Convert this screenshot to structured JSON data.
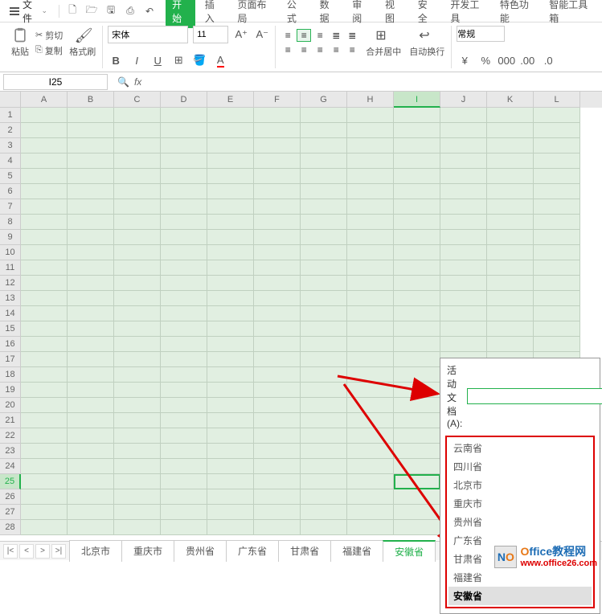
{
  "menu": {
    "file_label": "文件",
    "tabs": [
      "开始",
      "插入",
      "页面布局",
      "公式",
      "数据",
      "审阅",
      "视图",
      "安全",
      "开发工具",
      "特色功能",
      "智能工具箱"
    ],
    "active_tab": 0
  },
  "ribbon": {
    "paste_label": "粘贴",
    "cut_label": "剪切",
    "copy_label": "复制",
    "format_painter_label": "格式刷",
    "font_name": "宋体",
    "font_size": "11",
    "merge_label": "合并居中",
    "wrap_label": "自动换行",
    "number_format": "常规"
  },
  "formula_bar": {
    "cell_ref": "I25"
  },
  "grid": {
    "columns": [
      "A",
      "B",
      "C",
      "D",
      "E",
      "F",
      "G",
      "H",
      "I",
      "J",
      "K",
      "L"
    ],
    "selected_col": "I",
    "row_count": 28,
    "selected_row": 25
  },
  "popup": {
    "label": "活动文档(A):",
    "input_value": "",
    "items": [
      "云南省",
      "四川省",
      "北京市",
      "重庆市",
      "贵州省",
      "广东省",
      "甘肃省",
      "福建省",
      "安徽省"
    ],
    "active_index": 8
  },
  "sheets": {
    "tabs": [
      "北京市",
      "重庆市",
      "贵州省",
      "广东省",
      "甘肃省",
      "福建省",
      "安徽省"
    ],
    "active_index": 6,
    "more_label": "⋯",
    "add_label": "+"
  },
  "watermark": {
    "line1_o": "O",
    "line1_rest": "ffice教程网",
    "line2": "www.office26.com"
  }
}
